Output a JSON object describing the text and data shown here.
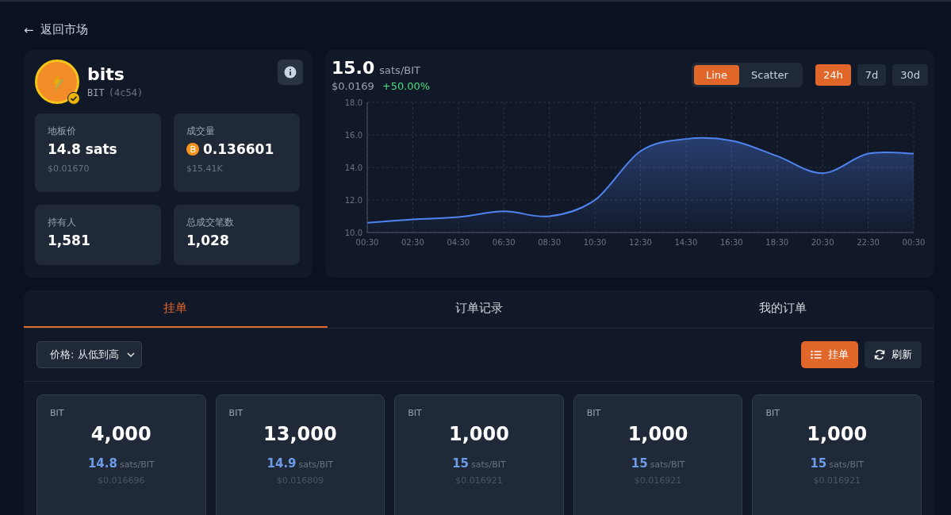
{
  "back_link": {
    "arrow": "←",
    "label": "返回市场"
  },
  "token": {
    "name": "bits",
    "ticker": "BIT",
    "id": "(4c54)",
    "verified": true
  },
  "stats": [
    {
      "label": "地板价",
      "value": "14.8 sats",
      "sub": "$0.01670",
      "kind": "plain"
    },
    {
      "label": "成交量",
      "value": "0.136601",
      "sub": "$15.41K",
      "kind": "btc"
    },
    {
      "label": "持有人",
      "value": "1,581",
      "kind": "plain"
    },
    {
      "label": "总成交笔数",
      "value": "1,028",
      "kind": "plain"
    }
  ],
  "price": {
    "value": "15.0",
    "unit": "sats/BIT",
    "usd": "$0.0169",
    "change": "+50.00%"
  },
  "chart_modes": [
    {
      "label": "Line",
      "selected": true
    },
    {
      "label": "Scatter",
      "selected": false
    }
  ],
  "ranges": [
    {
      "label": "24h",
      "selected": true
    },
    {
      "label": "7d",
      "selected": false
    },
    {
      "label": "30d",
      "selected": false
    }
  ],
  "chart_data": {
    "type": "area",
    "categories": [
      "00:30",
      "02:30",
      "04:30",
      "06:30",
      "08:30",
      "10:30",
      "12:30",
      "14:30",
      "16:30",
      "18:30",
      "20:30",
      "22:30",
      "00:30"
    ],
    "grid": true,
    "series": [
      {
        "color": "#4f83f0",
        "values": [
          10.6,
          10.8,
          10.95,
          11.3,
          11.0,
          12.0,
          15.0,
          15.75,
          15.65,
          14.7,
          13.65,
          14.85,
          14.85
        ]
      }
    ],
    "ylim": [
      10,
      18
    ],
    "yticks": [
      {
        "value": 10,
        "label": "10.0"
      },
      {
        "value": 12,
        "label": "12.0"
      },
      {
        "value": 14,
        "label": "14.0"
      },
      {
        "value": 16,
        "label": "16.0"
      },
      {
        "value": 18,
        "label": "18.0"
      }
    ]
  },
  "tabs": [
    {
      "label": "挂单",
      "selected": true
    },
    {
      "label": "订单记录",
      "selected": false
    },
    {
      "label": "我的订单",
      "selected": false
    }
  ],
  "sort_select": {
    "value": "价格: 从低到高"
  },
  "actions": [
    {
      "label": "挂单",
      "kind": "primary"
    },
    {
      "label": "刷新",
      "kind": "secondary"
    }
  ],
  "listings": [
    {
      "ticker": "BIT",
      "amount": "4,000",
      "price": "14.8",
      "unit": "sats/BIT",
      "usd": "$0.016696"
    },
    {
      "ticker": "BIT",
      "amount": "13,000",
      "price": "14.9",
      "unit": "sats/BIT",
      "usd": "$0.016809"
    },
    {
      "ticker": "BIT",
      "amount": "1,000",
      "price": "15",
      "unit": "sats/BIT",
      "usd": "$0.016921"
    },
    {
      "ticker": "BIT",
      "amount": "1,000",
      "price": "15",
      "unit": "sats/BIT",
      "usd": "$0.016921"
    },
    {
      "ticker": "BIT",
      "amount": "1,000",
      "price": "15",
      "unit": "sats/BIT",
      "usd": "$0.016921"
    }
  ]
}
